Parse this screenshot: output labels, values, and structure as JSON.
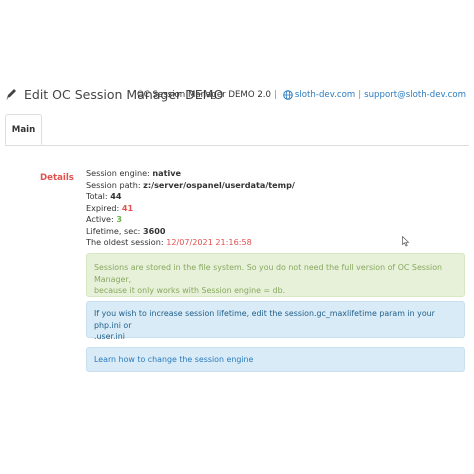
{
  "header": {
    "title": "Edit OC Session Manager DEMO",
    "module_version": "OC Session Manager DEMO 2.0",
    "separator": "|",
    "site_link": "sloth-dev.com",
    "support_link": "support@sloth-dev.com",
    "title_icon": "pencil-icon",
    "site_icon": "globe-icon"
  },
  "tabs": [
    {
      "label": "Main",
      "active": true
    }
  ],
  "details": {
    "label": "Details",
    "session_engine_label": "Session engine:",
    "session_engine_value": "native",
    "session_path_label": "Session path:",
    "session_path_value": "z:/server/ospanel/userdata/temp/",
    "total_label": "Total:",
    "total_value": "44",
    "expired_label": "Expired:",
    "expired_value": "41",
    "active_label": "Active:",
    "active_value": "3",
    "lifetime_label": "Lifetime, sec:",
    "lifetime_value": "3600",
    "oldest_label": "The oldest session:",
    "oldest_value": "12/07/2021 21:16:58"
  },
  "alerts": {
    "file_system_line1": "Sessions are stored in the file system. So you do not need the full version of OC Session Manager,",
    "file_system_line2": "because it only works with Session engine = db.",
    "lifetime_line1": "If you wish to increase session lifetime, edit the session.gc_maxlifetime param in your php.ini or",
    "lifetime_line2": ".user.ini",
    "learn_link": "Learn how to change the session engine"
  },
  "colors": {
    "danger": "#e0524f",
    "success": "#6ab04c",
    "link": "#2a7bbf",
    "alert_success_bg": "#e7f1d9",
    "alert_info_bg": "#d9ebf6"
  }
}
